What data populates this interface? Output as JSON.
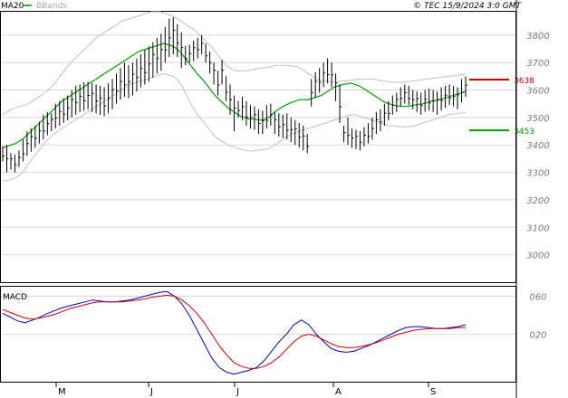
{
  "header": {
    "ma_label": "MA20",
    "bb_label": "BBands",
    "copyright": "© TEC 15/9/2024 3:0 GMT"
  },
  "colors": {
    "bars": "#000000",
    "ma": "#00a000",
    "bbands": "#c0c0c0",
    "resistance": "#cc0000",
    "support": "#00a000",
    "macd_line": "#0000cc",
    "signal_line": "#cc0000",
    "grid": "#d8d8d8",
    "axis_text": "#7a7a7a"
  },
  "chart_data": [
    {
      "type": "ohlc",
      "x_labels": [
        "M",
        "J",
        "J",
        "A",
        "S"
      ],
      "yticks": [
        3000,
        3100,
        3200,
        3300,
        3400,
        3500,
        3600,
        3700,
        3800
      ],
      "ylim": [
        2900,
        3885
      ],
      "levels": [
        {
          "name": "resistance",
          "value": 3638,
          "label": "3638"
        },
        {
          "name": "support",
          "value": 3453,
          "label": "3453"
        }
      ],
      "series": {
        "highs": [
          3395,
          3400,
          3370,
          3365,
          3380,
          3420,
          3450,
          3460,
          3470,
          3485,
          3510,
          3520,
          3515,
          3550,
          3560,
          3570,
          3580,
          3600,
          3615,
          3620,
          3628,
          3630,
          3625,
          3620,
          3615,
          3610,
          3625,
          3640,
          3660,
          3680,
          3700,
          3690,
          3700,
          3715,
          3730,
          3745,
          3760,
          3775,
          3790,
          3805,
          3830,
          3860,
          3865,
          3840,
          3810,
          3760,
          3765,
          3780,
          3790,
          3800,
          3770,
          3740,
          3700,
          3670,
          3710,
          3650,
          3620,
          3580,
          3560,
          3575,
          3560,
          3545,
          3540,
          3530,
          3525,
          3545,
          3550,
          3520,
          3515,
          3510,
          3515,
          3500,
          3490,
          3480,
          3470,
          3440,
          3640,
          3665,
          3680,
          3700,
          3715,
          3700,
          3660,
          3620,
          3470,
          3500,
          3460,
          3455,
          3450,
          3465,
          3480,
          3500,
          3520,
          3530,
          3550,
          3560,
          3580,
          3590,
          3610,
          3620,
          3615,
          3600,
          3595,
          3590,
          3600,
          3605,
          3600,
          3595,
          3610,
          3615,
          3620,
          3615,
          3610,
          3640,
          3650
        ],
        "lows": [
          3340,
          3300,
          3310,
          3300,
          3320,
          3340,
          3360,
          3375,
          3390,
          3405,
          3420,
          3435,
          3450,
          3460,
          3470,
          3480,
          3490,
          3500,
          3510,
          3520,
          3525,
          3530,
          3520,
          3515,
          3510,
          3505,
          3515,
          3530,
          3550,
          3565,
          3575,
          3570,
          3580,
          3595,
          3610,
          3620,
          3630,
          3645,
          3660,
          3670,
          3700,
          3720,
          3730,
          3720,
          3680,
          3690,
          3700,
          3705,
          3715,
          3730,
          3700,
          3660,
          3620,
          3580,
          3620,
          3560,
          3510,
          3450,
          3500,
          3490,
          3470,
          3460,
          3455,
          3440,
          3440,
          3460,
          3470,
          3440,
          3430,
          3425,
          3420,
          3410,
          3400,
          3390,
          3380,
          3370,
          3540,
          3570,
          3590,
          3610,
          3625,
          3610,
          3560,
          3480,
          3410,
          3400,
          3390,
          3385,
          3380,
          3395,
          3405,
          3420,
          3440,
          3450,
          3470,
          3490,
          3510,
          3520,
          3540,
          3550,
          3545,
          3530,
          3520,
          3510,
          3520,
          3525,
          3520,
          3510,
          3525,
          3535,
          3545,
          3540,
          3530,
          3555,
          3575
        ],
        "ma20": [
          3390,
          3395,
          3400,
          3405,
          3415,
          3425,
          3440,
          3455,
          3470,
          3485,
          3500,
          3515,
          3530,
          3545,
          3560,
          3570,
          3580,
          3590,
          3600,
          3610,
          3620,
          3630,
          3640,
          3650,
          3660,
          3670,
          3680,
          3690,
          3700,
          3710,
          3720,
          3730,
          3740,
          3745,
          3750,
          3755,
          3760,
          3765,
          3770,
          3765,
          3760,
          3750,
          3735,
          3715,
          3695,
          3675,
          3655,
          3640,
          3620,
          3600,
          3580,
          3565,
          3550,
          3535,
          3525,
          3515,
          3505,
          3500,
          3495,
          3495,
          3492,
          3490,
          3495,
          3505,
          3520,
          3530,
          3540,
          3548,
          3555,
          3560,
          3565,
          3565,
          3565,
          3570,
          3575,
          3580,
          3590,
          3600,
          3610,
          3615,
          3620,
          3622,
          3625,
          3620,
          3615,
          3605,
          3595,
          3585,
          3575,
          3565,
          3555,
          3550,
          3545,
          3542,
          3540,
          3540,
          3542,
          3545,
          3548,
          3550,
          3555,
          3560,
          3562,
          3565,
          3570,
          3575,
          3580,
          3585,
          3590,
          3595
        ],
        "bb_upper": [
          3510,
          3520,
          3530,
          3535,
          3540,
          3545,
          3550,
          3560,
          3570,
          3580,
          3590,
          3605,
          3620,
          3640,
          3660,
          3680,
          3700,
          3715,
          3730,
          3745,
          3760,
          3775,
          3790,
          3800,
          3810,
          3820,
          3830,
          3840,
          3850,
          3855,
          3860,
          3865,
          3870,
          3875,
          3880,
          3885,
          3885,
          3885,
          3880,
          3875,
          3870,
          3860,
          3850,
          3840,
          3830,
          3820,
          3805,
          3790,
          3775,
          3760,
          3740,
          3720,
          3700,
          3685,
          3675,
          3670,
          3668,
          3670,
          3672,
          3675,
          3678,
          3680,
          3682,
          3685,
          3688,
          3690,
          3690,
          3690,
          3688,
          3685,
          3680,
          3670,
          3660,
          3650,
          3640,
          3635,
          3632,
          3630,
          3630,
          3630,
          3632,
          3634,
          3636,
          3638,
          3640,
          3640,
          3640,
          3640,
          3638,
          3635,
          3632,
          3630,
          3628,
          3628,
          3628,
          3630,
          3632,
          3634,
          3636,
          3638,
          3640,
          3642,
          3644,
          3646,
          3648,
          3650,
          3652,
          3654,
          3656,
          3658
        ],
        "bb_lower": [
          3270,
          3270,
          3275,
          3280,
          3290,
          3305,
          3330,
          3350,
          3370,
          3390,
          3410,
          3425,
          3440,
          3450,
          3460,
          3470,
          3480,
          3490,
          3500,
          3510,
          3520,
          3530,
          3540,
          3550,
          3560,
          3570,
          3580,
          3590,
          3600,
          3610,
          3620,
          3625,
          3630,
          3635,
          3640,
          3645,
          3650,
          3655,
          3660,
          3655,
          3650,
          3640,
          3620,
          3590,
          3560,
          3530,
          3505,
          3490,
          3470,
          3450,
          3430,
          3420,
          3410,
          3400,
          3395,
          3390,
          3385,
          3380,
          3378,
          3378,
          3380,
          3382,
          3385,
          3390,
          3400,
          3410,
          3420,
          3430,
          3440,
          3445,
          3450,
          3455,
          3460,
          3465,
          3470,
          3475,
          3480,
          3485,
          3490,
          3495,
          3500,
          3505,
          3510,
          3510,
          3505,
          3500,
          3495,
          3490,
          3485,
          3480,
          3475,
          3470,
          3470,
          3468,
          3466,
          3466,
          3468,
          3470,
          3475,
          3480,
          3485,
          3490,
          3495,
          3500,
          3505,
          3510,
          3512,
          3514,
          3516,
          3518
        ]
      }
    },
    {
      "type": "line",
      "title": "MACD",
      "yticks": [
        0.2,
        0.6
      ],
      "ytick_labels": [
        "020",
        "060"
      ],
      "ylim": [
        -0.3,
        0.7
      ],
      "series": [
        {
          "name": "macd",
          "values": [
            0.42,
            0.38,
            0.34,
            0.32,
            0.35,
            0.38,
            0.42,
            0.45,
            0.48,
            0.5,
            0.52,
            0.54,
            0.56,
            0.55,
            0.54,
            0.54,
            0.55,
            0.56,
            0.58,
            0.6,
            0.62,
            0.64,
            0.65,
            0.6,
            0.52,
            0.4,
            0.25,
            0.1,
            -0.05,
            -0.15,
            -0.2,
            -0.22,
            -0.2,
            -0.18,
            -0.15,
            -0.08,
            0.02,
            0.12,
            0.2,
            0.3,
            0.35,
            0.3,
            0.2,
            0.12,
            0.05,
            0.02,
            0.01,
            0.02,
            0.05,
            0.08,
            0.12,
            0.16,
            0.2,
            0.24,
            0.27,
            0.28,
            0.28,
            0.27,
            0.26,
            0.26,
            0.27,
            0.28,
            0.3
          ]
        },
        {
          "name": "signal",
          "values": [
            0.46,
            0.43,
            0.4,
            0.37,
            0.36,
            0.37,
            0.39,
            0.41,
            0.44,
            0.47,
            0.49,
            0.51,
            0.53,
            0.54,
            0.54,
            0.54,
            0.54,
            0.55,
            0.56,
            0.57,
            0.59,
            0.6,
            0.61,
            0.6,
            0.56,
            0.5,
            0.42,
            0.32,
            0.2,
            0.08,
            -0.02,
            -0.1,
            -0.14,
            -0.16,
            -0.16,
            -0.14,
            -0.1,
            -0.04,
            0.04,
            0.12,
            0.18,
            0.2,
            0.18,
            0.14,
            0.1,
            0.07,
            0.06,
            0.06,
            0.07,
            0.09,
            0.11,
            0.14,
            0.17,
            0.2,
            0.22,
            0.24,
            0.25,
            0.26,
            0.26,
            0.26,
            0.26,
            0.27,
            0.27
          ]
        }
      ]
    }
  ]
}
